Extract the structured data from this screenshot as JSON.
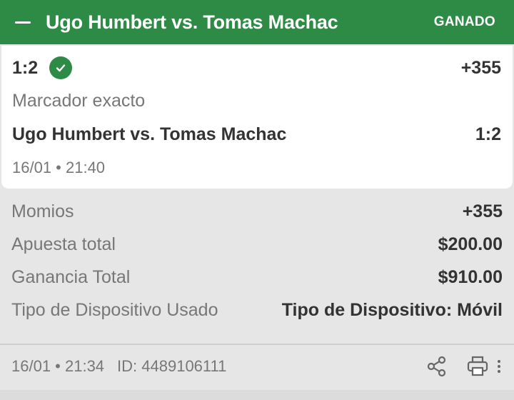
{
  "header": {
    "title": "Ugo Humbert vs. Tomas Machac",
    "status": "GANADO",
    "collapse_icon": "minus-icon"
  },
  "selection": {
    "pick": "1:2",
    "status_icon": "check-circle-icon",
    "odds": "+355",
    "market": "Marcador exacto",
    "event": "Ugo Humbert vs. Tomas Machac",
    "event_result": "1:2",
    "event_time": "16/01 • 21:40"
  },
  "summary": {
    "rows": [
      {
        "label": "Momios",
        "value": "+355"
      },
      {
        "label": "Apuesta total",
        "value": "$200.00"
      },
      {
        "label": "Ganancia Total",
        "value": "$910.00"
      },
      {
        "label": "Tipo de Dispositivo Usado",
        "value": "Tipo de Dispositivo: Móvil"
      }
    ]
  },
  "footer": {
    "placed_time": "16/01 • 21:34",
    "bet_id": "ID: 4489106111",
    "icons": [
      "share-icon",
      "print-icon",
      "more-vertical-icon"
    ]
  },
  "colors": {
    "accent": "#2e8b45",
    "text_primary": "#333333",
    "text_secondary": "#777777",
    "background": "#e6e6e6"
  }
}
